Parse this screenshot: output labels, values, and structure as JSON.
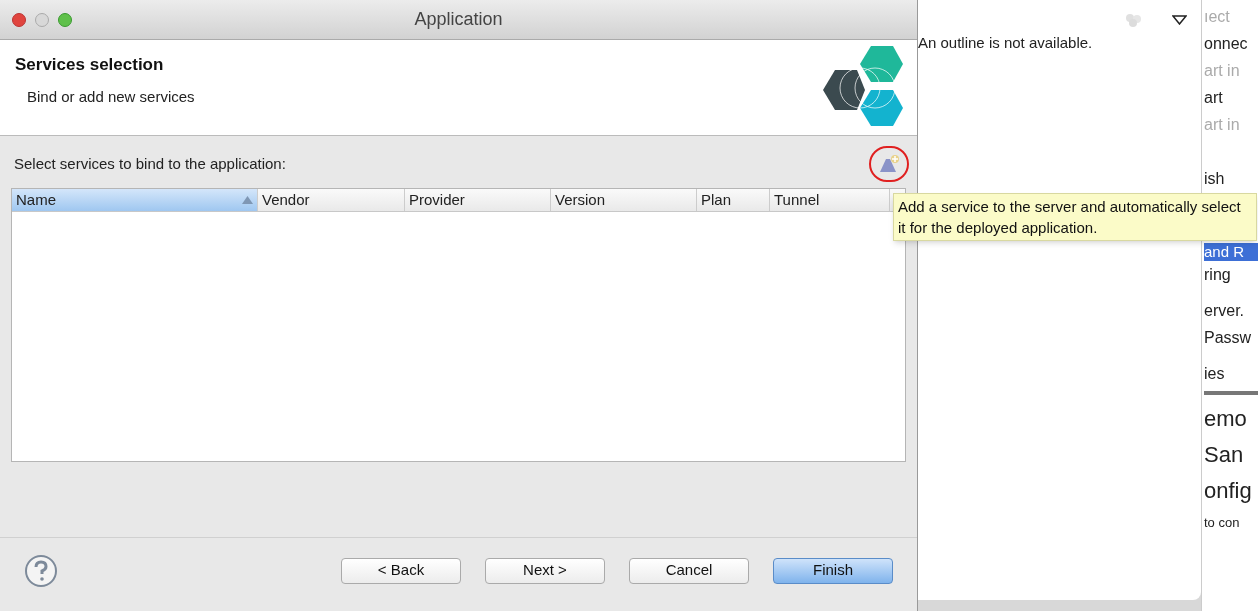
{
  "window": {
    "title": "Application"
  },
  "header": {
    "title": "Services selection",
    "subtitle": "Bind or add new services"
  },
  "table": {
    "label": "Select services to bind to the application:",
    "columns": [
      {
        "label": "Name",
        "selected": true
      },
      {
        "label": "Vendor",
        "selected": false
      },
      {
        "label": "Provider",
        "selected": false
      },
      {
        "label": "Version",
        "selected": false
      },
      {
        "label": "Plan",
        "selected": false
      },
      {
        "label": "Tunnel",
        "selected": false
      }
    ]
  },
  "tooltip": "Add a service to the server and automatically select it for the deployed application.",
  "buttons": [
    {
      "label": "< Back",
      "default": false
    },
    {
      "label": "Next >",
      "default": false
    },
    {
      "label": "Cancel",
      "default": false
    },
    {
      "label": "Finish",
      "default": true
    }
  ],
  "outline": {
    "message": "An outline is not available."
  },
  "background_fragments": [
    {
      "text": "ıect",
      "kind": "line",
      "disabled": true
    },
    {
      "text": "onnec",
      "kind": "line",
      "disabled": false
    },
    {
      "text": "art in",
      "kind": "line",
      "disabled": true
    },
    {
      "text": "art",
      "kind": "line",
      "disabled": false
    },
    {
      "text": "art in",
      "kind": "line",
      "disabled": true
    },
    {
      "text": "ish",
      "kind": "line",
      "disabled": false
    },
    {
      "text": "and R",
      "kind": "selected",
      "disabled": false
    },
    {
      "text": "ring",
      "kind": "line",
      "disabled": false
    },
    {
      "text": "erver.",
      "kind": "line",
      "disabled": false
    },
    {
      "text": "Passw",
      "kind": "line",
      "disabled": false
    },
    {
      "text": "ies",
      "kind": "tab",
      "disabled": false
    },
    {
      "text": "emo",
      "kind": "large",
      "disabled": false
    },
    {
      "text": "San",
      "kind": "large",
      "disabled": false
    },
    {
      "text": "onfig",
      "kind": "large",
      "disabled": false
    },
    {
      "text": "to con",
      "kind": "small",
      "disabled": false
    }
  ]
}
